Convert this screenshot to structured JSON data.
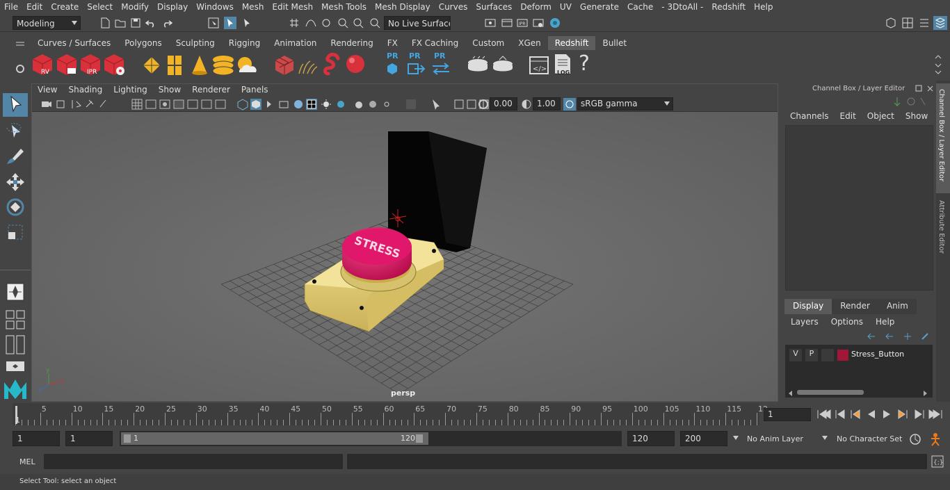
{
  "menu": [
    "File",
    "Edit",
    "Create",
    "Select",
    "Modify",
    "Display",
    "Windows",
    "Mesh",
    "Edit Mesh",
    "Mesh Tools",
    "Mesh Display",
    "Curves",
    "Surfaces",
    "Deform",
    "UV",
    "Generate",
    "Cache",
    "- 3DtoAll -",
    "Redshift",
    "Help"
  ],
  "status": {
    "mode": "Modeling",
    "live_surface": "No Live Surface"
  },
  "shelf_tabs": [
    "Curves / Surfaces",
    "Polygons",
    "Sculpting",
    "Rigging",
    "Animation",
    "Rendering",
    "FX",
    "FX Caching",
    "Custom",
    "XGen",
    "Redshift",
    "Bullet"
  ],
  "shelf_active": "Redshift",
  "shelf_labels": {
    "rv": "RV",
    "ipr": "IPR",
    "pr1": "PR",
    "pr2": "PR",
    "pr3": "PR",
    "log": ".LOG",
    "help": "?"
  },
  "viewport": {
    "menu": [
      "View",
      "Shading",
      "Lighting",
      "Show",
      "Renderer",
      "Panels"
    ],
    "exposure": "0.00",
    "gamma": "1.00",
    "colorspace": "sRGB gamma",
    "camera": "persp",
    "button_text": "STRESS"
  },
  "channel_box": {
    "title": "Channel Box / Layer Editor",
    "menu": [
      "Channels",
      "Edit",
      "Object",
      "Show"
    ],
    "layer_tabs": [
      "Display",
      "Render",
      "Anim"
    ],
    "layer_tab_active": "Display",
    "layer_menu": [
      "Layers",
      "Options",
      "Help"
    ],
    "layer": {
      "v": "V",
      "p": "P",
      "name": "Stress_Button",
      "color": "#a0173a"
    }
  },
  "side_tabs": [
    "Channel Box / Layer Editor",
    "Attribute Editor"
  ],
  "timeline": {
    "ticks": [
      "5",
      "10",
      "15",
      "20",
      "25",
      "30",
      "35",
      "40",
      "45",
      "50",
      "55",
      "60",
      "65",
      "70",
      "75",
      "80",
      "85",
      "90",
      "95",
      "100",
      "105",
      "110",
      "115",
      "12"
    ],
    "current_marker": "1",
    "current_frame": "1"
  },
  "range": {
    "start": "1",
    "start2": "1",
    "slider_start": "1",
    "slider_end": "120",
    "end": "120",
    "end2": "200",
    "anim_layer": "No Anim Layer",
    "char_set": "No Character Set"
  },
  "mel": {
    "label": "MEL"
  },
  "help_line": "Select Tool: select an object",
  "colors": {
    "accent": "#5285a6",
    "magenta": "#d8105a",
    "yellow": "#e2cf6e",
    "red_icon": "#d9313b",
    "gold_icon": "#f2b325"
  }
}
